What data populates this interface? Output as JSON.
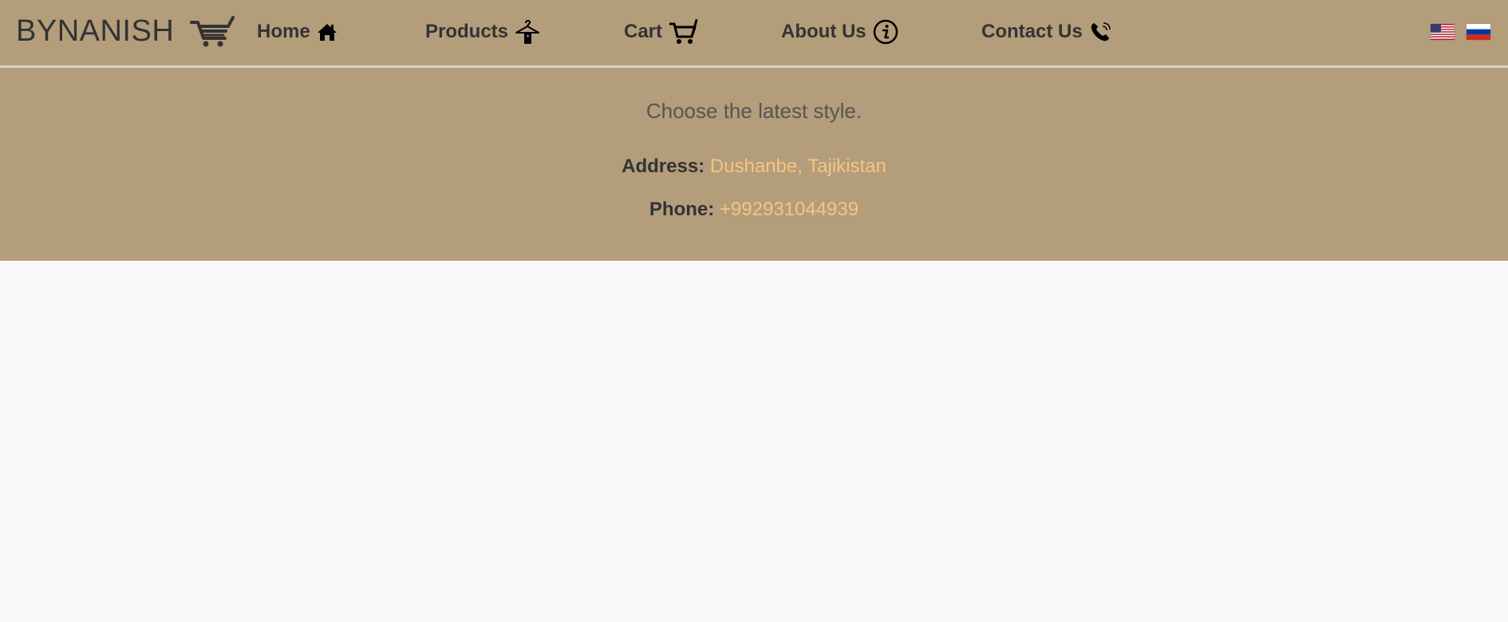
{
  "nav": {
    "brand": "BYNANISH",
    "brand_icon": "shopping-cart-icon",
    "items": [
      {
        "label": "Home",
        "icon": "home-icon"
      },
      {
        "label": "Products",
        "icon": "hanger-tag-icon"
      },
      {
        "label": "Cart",
        "icon": "cart-icon"
      },
      {
        "label": "About Us",
        "icon": "info-icon"
      },
      {
        "label": "Contact Us",
        "icon": "phone-icon"
      }
    ],
    "languages": [
      {
        "name": "English",
        "icon": "us-flag-icon"
      },
      {
        "name": "Russian",
        "icon": "russia-flag-icon"
      }
    ]
  },
  "header": {
    "tagline": "Choose the latest style.",
    "address_label": "Address:",
    "address_value": "Dushanbe, Tajikistan",
    "phone_label": "Phone:",
    "phone_value": "+992931044939"
  },
  "colors": {
    "header_bg": "#b49d7b",
    "accent": "#f6c57f",
    "text": "#333333",
    "page_bg": "#f9f9f9"
  }
}
